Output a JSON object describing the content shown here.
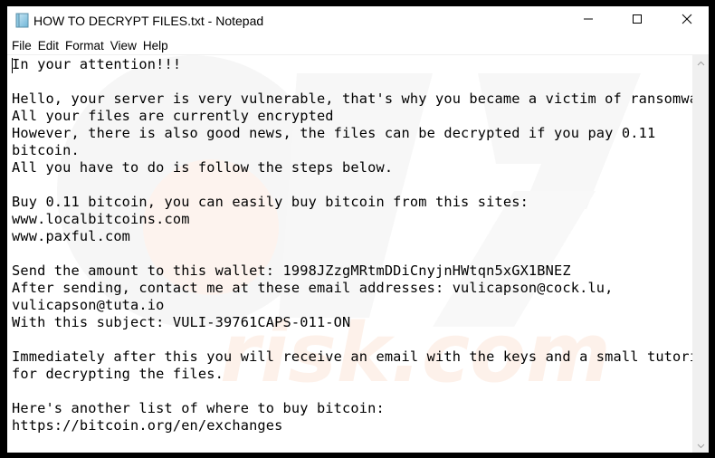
{
  "window": {
    "title": "HOW TO DECRYPT FILES.txt - Notepad",
    "icon": "notepad-icon",
    "controls": {
      "minimize_icon": "minimize-icon",
      "maximize_icon": "maximize-icon",
      "close_icon": "close-icon"
    }
  },
  "menubar": {
    "items": [
      {
        "label": "File"
      },
      {
        "label": "Edit"
      },
      {
        "label": "Format"
      },
      {
        "label": "View"
      },
      {
        "label": "Help"
      }
    ]
  },
  "editor": {
    "lines": [
      "In your attention!!!",
      "",
      "Hello, your server is very vulnerable, that's why you became a victim of ransomware",
      "All your files are currently encrypted",
      "However, there is also good news, the files can be decrypted if you pay 0.11",
      "bitcoin.",
      "All you have to do is follow the steps below.",
      "",
      "Buy 0.11 bitcoin, you can easily buy bitcoin from this sites:",
      "www.localbitcoins.com",
      "www.paxful.com",
      "",
      "Send the amount to this wallet: 1998JZzgMRtmDDiCnyjnHWtqn5xGX1BNEZ",
      "After sending, contact me at these email addresses: vulicapson@cock.lu,",
      "vulicapson@tuta.io",
      "With this subject: VULI-39761CAPS-011-ON",
      "",
      "Immediately after this you will receive an email with the keys and a small tutorial",
      "for decrypting the files.",
      "",
      "Here's another list of where to buy bitcoin:",
      "https://bitcoin.org/en/exchanges"
    ]
  },
  "scrollbar": {
    "up_icon": "scroll-up-arrow-icon",
    "down_icon": "scroll-down-arrow-icon"
  },
  "colors": {
    "watermark_gray": "#f4f4f4",
    "watermark_orange": "#fdf1ea"
  }
}
